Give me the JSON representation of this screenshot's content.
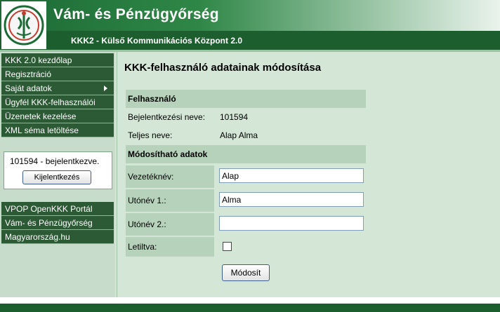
{
  "header": {
    "title": "Vám- és Pénzügyőrség",
    "subtitle": "KKK2 - Külső Kommunikációs Központ 2.0"
  },
  "sidebar": {
    "menu1": [
      {
        "label": "KKK 2.0 kezdőlap"
      },
      {
        "label": "Regisztráció"
      },
      {
        "label": "Saját adatok",
        "has_submenu": true
      },
      {
        "label": "Ügyfél KKK-felhasználói"
      },
      {
        "label": "Üzenetek kezelése"
      },
      {
        "label": "XML séma letöltése"
      }
    ],
    "login": {
      "status": "101594 - bejelentkezve.",
      "logout_label": "Kijelentkezés"
    },
    "menu2": [
      {
        "label": "VPOP OpenKKK Portál"
      },
      {
        "label": "Vám- és Pénzügyőrség"
      },
      {
        "label": "Magyarország.hu"
      }
    ]
  },
  "main": {
    "title": "KKK-felhasználó adatainak módosítása",
    "user_section": {
      "heading": "Felhasználó",
      "login_name_label": "Bejelentkezési neve:",
      "login_name_value": "101594",
      "full_name_label": "Teljes neve:",
      "full_name_value": "Alap Alma"
    },
    "edit_section": {
      "heading": "Módosítható adatok",
      "surname_label": "Vezetéknév:",
      "surname_value": "Alap",
      "firstname1_label": "Utónév 1.:",
      "firstname1_value": "Alma",
      "firstname2_label": "Utónév 2.:",
      "firstname2_value": "",
      "disabled_label": "Letiltva:",
      "disabled_checked": false,
      "submit_label": "Módosít"
    }
  },
  "colors": {
    "nav_bg": "#2b5a35",
    "header_green": "#1d5e2e",
    "section_bg": "#b6d2ba",
    "page_bg": "#d4e6d6"
  }
}
